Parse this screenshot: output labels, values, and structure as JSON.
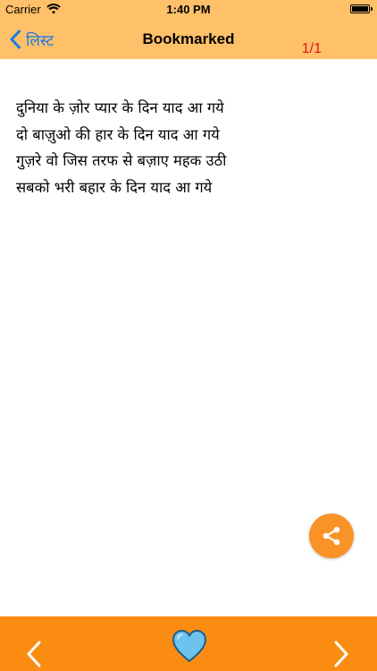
{
  "status_bar": {
    "carrier": "Carrier",
    "time": "1:40 PM"
  },
  "nav": {
    "back_label": "लिस्ट",
    "title": "Bookmarked",
    "counter": "1/1"
  },
  "content": {
    "lines": [
      "दुनिया के ज़ोर प्यार के दिन याद आ गये",
      "दो बाज़ुओ की हार के दिन याद आ गये",
      "गुज़रे वो जिस तरफ से बज़ाए महक उठी",
      "सबको भरी बहार के दिन याद आ गये"
    ]
  },
  "icons": {
    "back": "chevron-left-icon",
    "share": "share-icon",
    "prev": "chevron-left-icon",
    "next": "chevron-right-icon",
    "favorite": "heart-icon",
    "wifi": "wifi-icon",
    "battery": "battery-icon"
  },
  "colors": {
    "top_bar": "#fec068",
    "bottom_bar": "#fb8c12",
    "share_button": "#f99328",
    "back_link": "#1a7ae6",
    "counter": "#e81414",
    "heart": "#6cc3ee"
  }
}
